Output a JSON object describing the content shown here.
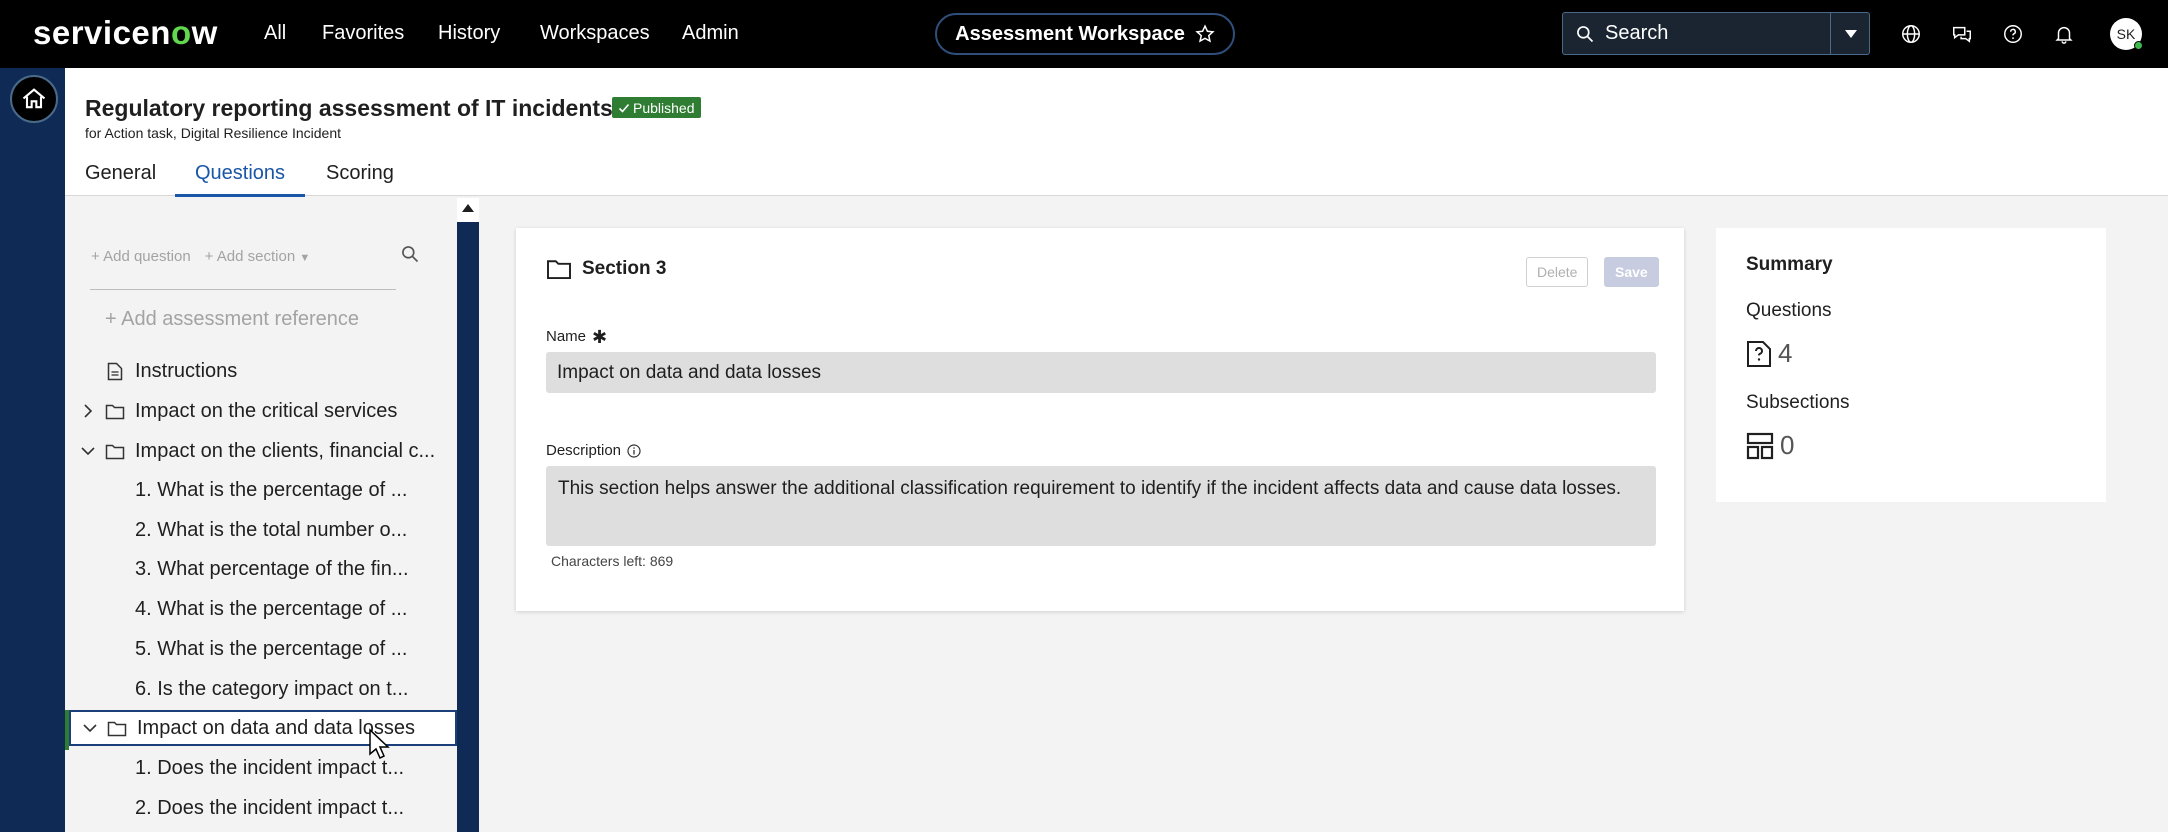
{
  "topbar": {
    "logo_main": "servicen",
    "logo_o": "o",
    "logo_end": "w",
    "nav": [
      "All",
      "Favorites",
      "History",
      "Workspaces",
      "Admin"
    ],
    "workspace_title": "Assessment Workspace",
    "search_placeholder": "Search",
    "avatar_initials": "SK"
  },
  "header": {
    "title": "Regulatory reporting assessment of IT incidents",
    "badge": "Published",
    "subtitle": "for Action task, Digital Resilience Incident",
    "tabs": [
      "General",
      "Questions",
      "Scoring"
    ],
    "active_tab": "Questions"
  },
  "tree": {
    "toolbar": {
      "add_question": "+ Add question",
      "add_section": "+ Add section"
    },
    "add_reference": "+ Add assessment reference",
    "items": [
      {
        "label": "Instructions",
        "type": "instructions"
      },
      {
        "label": "Impact on the critical services",
        "type": "section",
        "state": "collapsed"
      },
      {
        "label": "Impact on the clients, financial c...",
        "type": "section",
        "state": "expanded"
      },
      {
        "label": "1. What is the percentage of ...",
        "type": "question"
      },
      {
        "label": "2. What is the total number o...",
        "type": "question"
      },
      {
        "label": "3. What percentage of the fin...",
        "type": "question"
      },
      {
        "label": "4. What is the percentage of ...",
        "type": "question"
      },
      {
        "label": "5. What is the percentage of ...",
        "type": "question"
      },
      {
        "label": "6. Is the category impact on t...",
        "type": "question"
      },
      {
        "label": "Impact on data and data losses",
        "type": "section",
        "state": "expanded",
        "selected": true
      },
      {
        "label": "1. Does the incident impact t...",
        "type": "question"
      },
      {
        "label": "2. Does the incident impact t...",
        "type": "question"
      }
    ]
  },
  "card": {
    "title": "Section 3",
    "delete_label": "Delete",
    "save_label": "Save",
    "name_label": "Name",
    "name_value": "Impact on data and data losses",
    "description_label": "Description",
    "description_value": "This section helps answer the additional classification requirement to identify if the incident affects data and cause data losses.",
    "chars_left": "Characters left: 869"
  },
  "summary": {
    "title": "Summary",
    "questions_label": "Questions",
    "questions_count": "4",
    "subsections_label": "Subsections",
    "subsections_count": "0"
  },
  "colors": {
    "topbar": "#000000",
    "rail": "#0f2a55",
    "accent": "#1a56a8",
    "published": "#2e7d32"
  }
}
